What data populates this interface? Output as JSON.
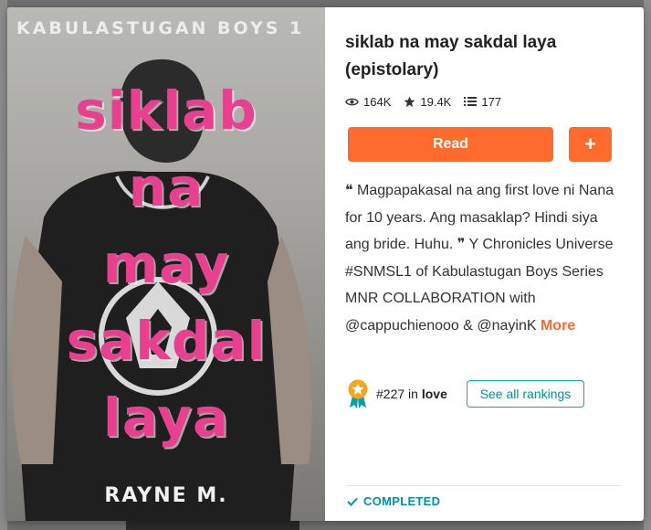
{
  "story": {
    "title": "siklab na may sakdal laya (epistolary)",
    "stats": {
      "reads": "164K",
      "votes": "19.4K",
      "parts": "177"
    },
    "read_label": "Read",
    "add_label": "+",
    "description": "❝ Magpapakasal na ang first love ni Nana for 10 years. Ang masaklap? Hindi siya ang bride. Huhu. ❞ Y Chronicles Universe #SNMSL1 of Kabulastugan Boys Series MNR COLLABORATION with @cappuchienooo & @nayinK",
    "more_label": "More",
    "ranking": {
      "rank": "#227",
      "in": "in",
      "tag": "love",
      "see_all_label": "See all rankings"
    },
    "status": "COMPLETED"
  },
  "cover": {
    "series": "KABULASTUGAN BOYS 1",
    "title_lines": [
      "siklab",
      "na",
      "may",
      "sakdal",
      "laya"
    ],
    "author": "RAYNE M."
  },
  "colors": {
    "accent": "#fe6b2d",
    "teal": "#00929e",
    "title_pink": "#e8408e"
  },
  "icons": [
    "eye-icon",
    "star-icon",
    "list-icon",
    "ribbon-badge-icon",
    "check-icon"
  ]
}
